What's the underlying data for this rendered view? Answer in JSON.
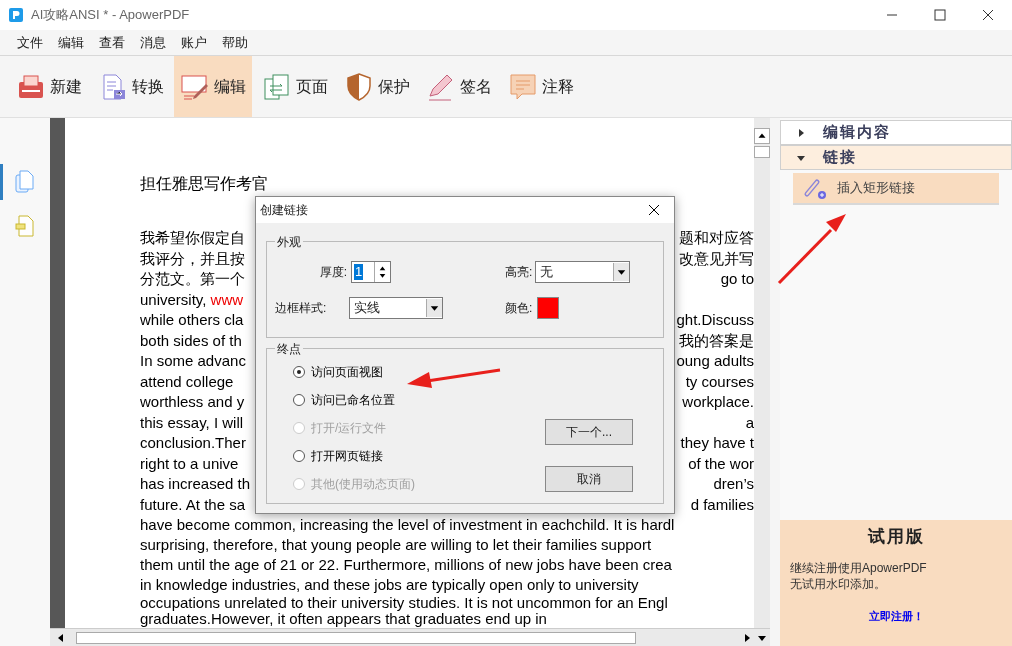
{
  "window": {
    "title": "AI攻略ANSI * - ApowerPDF"
  },
  "menu": [
    "文件",
    "编辑",
    "查看",
    "消息",
    "账户",
    "帮助"
  ],
  "toolbar": [
    {
      "label": "新建",
      "selected": false
    },
    {
      "label": "转换",
      "selected": false
    },
    {
      "label": "编辑",
      "selected": true
    },
    {
      "label": "页面",
      "selected": false
    },
    {
      "label": "保护",
      "selected": false
    },
    {
      "label": "签名",
      "selected": false
    },
    {
      "label": "注释",
      "selected": false
    }
  ],
  "left_tools": [
    {
      "selected": true
    },
    {
      "selected": false
    }
  ],
  "document": {
    "heading": "担任雅思写作考官",
    "lines": [
      {
        "left": "我希望你假定自",
        "right": "题和对应答"
      },
      {
        "left": "我评分，并且按",
        "right": "改意见并写"
      },
      {
        "left": "分范文。第一个",
        "right": "go to"
      },
      {
        "left": "university, **www**"
      },
      {
        "left": "while others cla",
        "right": "ght.Discuss"
      },
      {
        "left": "both sides of th",
        "right": "我的答案是"
      },
      {
        "left": "In some advanc",
        "right": "oung adults"
      },
      {
        "left": "attend college",
        "right": "ty courses"
      },
      {
        "left": "worthless and y",
        "right": "workplace."
      },
      {
        "left": "this essay, I will",
        "right": "a"
      },
      {
        "left": "conclusion.Ther",
        "right": "they have t"
      },
      {
        "left": "right to a unive",
        "right": "of the wor"
      },
      {
        "left": "has increased th",
        "right": "dren’s"
      },
      {
        "left": "future. At the sa",
        "right": "d families"
      },
      {
        "left": "have become common, increasing the level of investment in eachchild. It is hardl"
      },
      {
        "left": "surprising, therefore, that young people are willing to let their families support"
      },
      {
        "left": "them until the age of 21 or 22. Furthermore, millions of new jobs have been crea"
      },
      {
        "left": "in knowledge industries, and these jobs are typically open only to university"
      }
    ],
    "overlap_lines": [
      "occupations unrelated to their university studies. It is not uncommon for an Engl",
      "graduates.However, it often appears that graduates end up in"
    ]
  },
  "dialog": {
    "title": "创建链接",
    "appearance": {
      "legend": "外观",
      "thickness_label": "厚度:",
      "thickness": "1",
      "highlight_label": "高亮:",
      "highlight": "无",
      "border_label": "边框样式:",
      "border": "实线",
      "color_label": "颜色:",
      "color": "#ff0000"
    },
    "destination": {
      "legend": "终点",
      "options": [
        {
          "label": "访问页面视图",
          "selected": true,
          "disabled": false
        },
        {
          "label": "访问已命名位置",
          "selected": false,
          "disabled": false
        },
        {
          "label": "打开/运行文件",
          "selected": false,
          "disabled": true
        },
        {
          "label": "打开网页链接",
          "selected": false,
          "disabled": false
        },
        {
          "label": "其他(使用动态页面)",
          "selected": false,
          "disabled": true
        }
      ]
    },
    "buttons": [
      "下一个...",
      "取消"
    ]
  },
  "panel": {
    "sections": [
      {
        "label": "编辑内容",
        "expanded": false
      },
      {
        "label": "链接",
        "expanded": true,
        "items": [
          "插入矩形链接"
        ]
      }
    ],
    "trial": {
      "title": "试用版",
      "lines": [
        "继续注册使用ApowerPDF",
        "无试用水印添加。"
      ],
      "link": "立即注册！"
    }
  }
}
